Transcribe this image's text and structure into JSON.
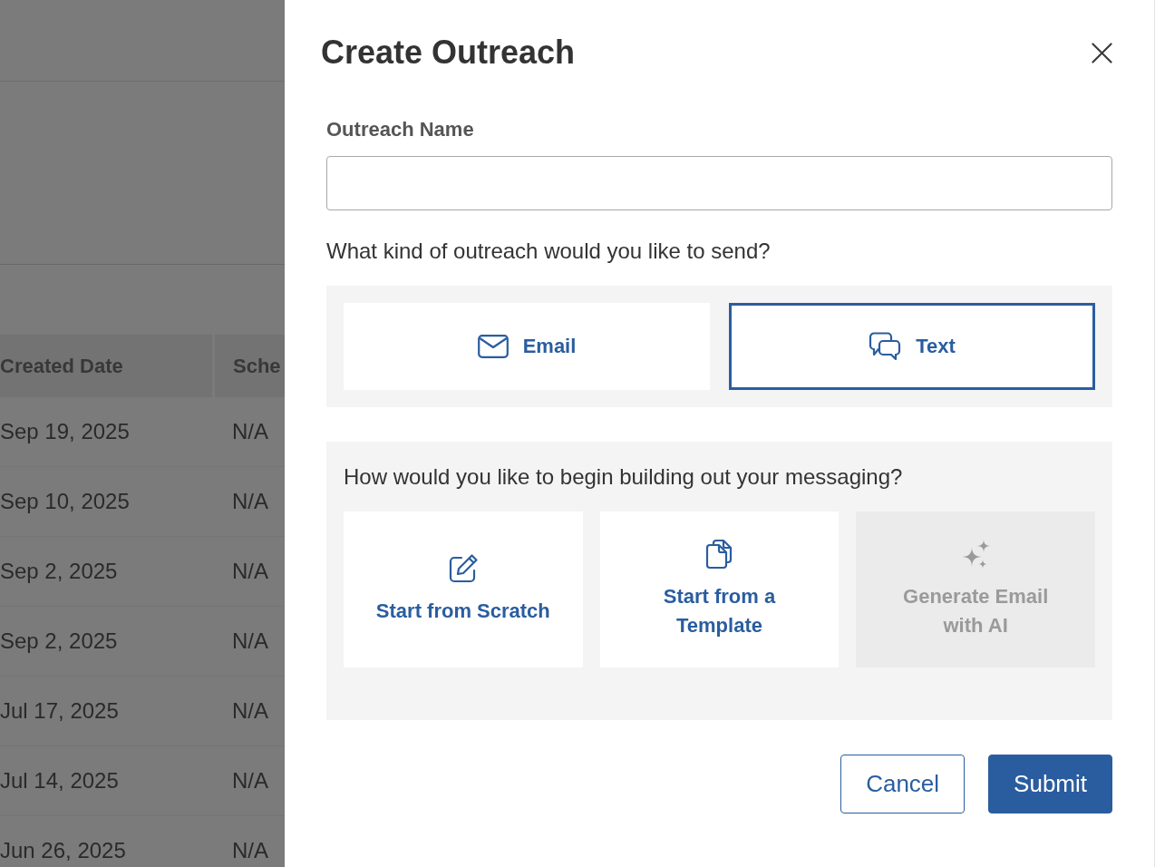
{
  "background_page": {
    "table": {
      "columns": [
        "Created Date",
        "Sche"
      ],
      "rows": [
        [
          "Sep 19, 2025",
          "N/A"
        ],
        [
          "Sep 10, 2025",
          "N/A"
        ],
        [
          "Sep 2, 2025",
          "N/A"
        ],
        [
          "Sep 2, 2025",
          "N/A"
        ],
        [
          "Jul 17, 2025",
          "N/A"
        ],
        [
          "Jul 14, 2025",
          "N/A"
        ],
        [
          "Jun 26, 2025",
          "N/A"
        ]
      ]
    }
  },
  "drawer": {
    "title": "Create Outreach",
    "name_field": {
      "label": "Outreach Name"
    },
    "type_question": "What kind of outreach would you like to send?",
    "type_options": [
      {
        "label": "Email",
        "kind": "email",
        "selected": false
      },
      {
        "label": "Text",
        "kind": "text",
        "selected": true
      }
    ],
    "start_question": "How would you like to begin building out your messaging?",
    "start_options": [
      {
        "label": "Start from Scratch",
        "kind": "scratch",
        "disabled": false
      },
      {
        "label": "Start from a Template",
        "kind": "template",
        "disabled": false
      },
      {
        "label": "Generate Email with AI",
        "kind": "ai",
        "disabled": true
      }
    ],
    "buttons": [
      {
        "label": "Cancel",
        "kind": "secondary"
      },
      {
        "label": "Submit",
        "kind": "primary"
      }
    ]
  }
}
